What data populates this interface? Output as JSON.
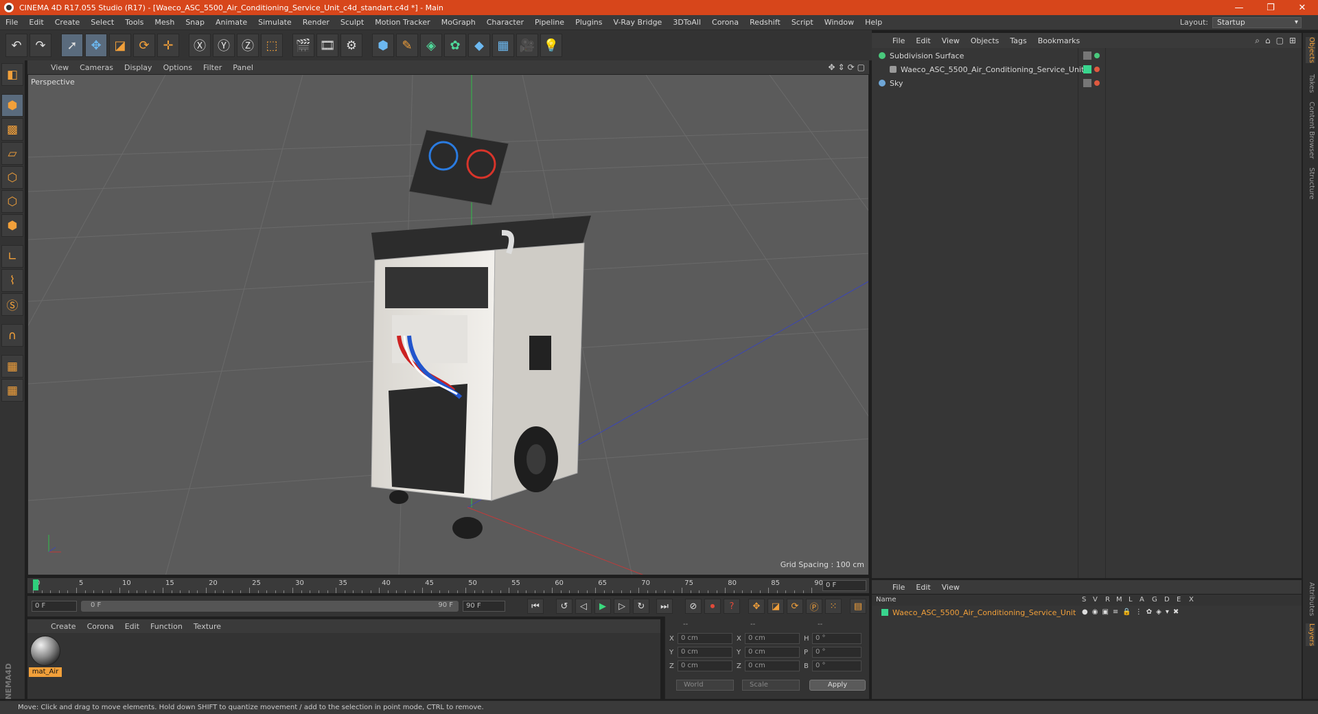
{
  "titlebar": {
    "title": "CINEMA 4D R17.055 Studio (R17) - [Waeco_ASC_5500_Air_Conditioning_Service_Unit_c4d_standart.c4d *] - Main",
    "minimize": "—",
    "restore": "❐",
    "close": "✕"
  },
  "menu": {
    "items": [
      "File",
      "Edit",
      "Create",
      "Select",
      "Tools",
      "Mesh",
      "Snap",
      "Animate",
      "Simulate",
      "Render",
      "Sculpt",
      "Motion Tracker",
      "MoGraph",
      "Character",
      "Pipeline",
      "Plugins",
      "V-Ray Bridge",
      "3DToAll",
      "Corona",
      "Redshift",
      "Script",
      "Window",
      "Help"
    ],
    "layout_label": "Layout:",
    "layout_value": "Startup"
  },
  "viewport": {
    "menu": [
      "View",
      "Cameras",
      "Display",
      "Options",
      "Filter",
      "Panel"
    ],
    "label": "Perspective",
    "grid_spacing": "Grid Spacing : 100 cm",
    "nav_icons": [
      "✥",
      "⇕",
      "⟳",
      "▢"
    ]
  },
  "timeline": {
    "ticks": [
      "0",
      "5",
      "10",
      "15",
      "20",
      "25",
      "30",
      "35",
      "40",
      "45",
      "50",
      "55",
      "60",
      "65",
      "70",
      "75",
      "80",
      "85",
      "90"
    ],
    "current_frame": "0 F",
    "start_field": "0 F",
    "range_start": "0 F",
    "range_end": "90 F",
    "end_field": "90 F"
  },
  "material_panel": {
    "menu": [
      "Create",
      "Corona",
      "Edit",
      "Function",
      "Texture"
    ],
    "material_name": "mat_Air"
  },
  "coordinates": {
    "headers": [
      "--",
      "--",
      "--"
    ],
    "rows": [
      {
        "a": "X",
        "av": "0 cm",
        "b": "X",
        "bv": "0 cm",
        "c": "H",
        "cv": "0 °"
      },
      {
        "a": "Y",
        "av": "0 cm",
        "b": "Y",
        "bv": "0 cm",
        "c": "P",
        "cv": "0 °"
      },
      {
        "a": "Z",
        "av": "0 cm",
        "b": "Z",
        "bv": "0 cm",
        "c": "B",
        "cv": "0 °"
      }
    ],
    "world": "World",
    "scale": "Scale",
    "apply": "Apply"
  },
  "status": "Move: Click and drag to move elements. Hold down SHIFT to quantize movement / add to the selection in point mode, CTRL to remove.",
  "object_manager": {
    "menu": [
      "File",
      "Edit",
      "View",
      "Objects",
      "Tags",
      "Bookmarks"
    ],
    "objects": [
      {
        "name": "Subdivision Surface",
        "icon_color": "#49c97c",
        "dot_color": "#49c97c"
      },
      {
        "name": "Waeco_ASC_5500_Air_Conditioning_Service_Unit",
        "icon_color": "#9a9a9a",
        "dot_color": "#e0593f"
      },
      {
        "name": "Sky",
        "icon_color": "#6fa7d8",
        "dot_color": "#e0593f"
      }
    ]
  },
  "right_tabs": [
    "Objects",
    "Takes",
    "Content Browser",
    "Structure",
    "Attributes",
    "Layers"
  ],
  "layer_manager": {
    "menu": [
      "File",
      "Edit",
      "View"
    ],
    "columns": [
      "Name",
      "S",
      "V",
      "R",
      "M",
      "L",
      "A",
      "G",
      "D",
      "E",
      "X"
    ],
    "layer_name": "Waeco_ASC_5500_Air_Conditioning_Service_Unit"
  },
  "colors": {
    "accent": "#f2a03a",
    "titlebar": "#d7461b",
    "viewport_bg": "#5b5b5b"
  }
}
